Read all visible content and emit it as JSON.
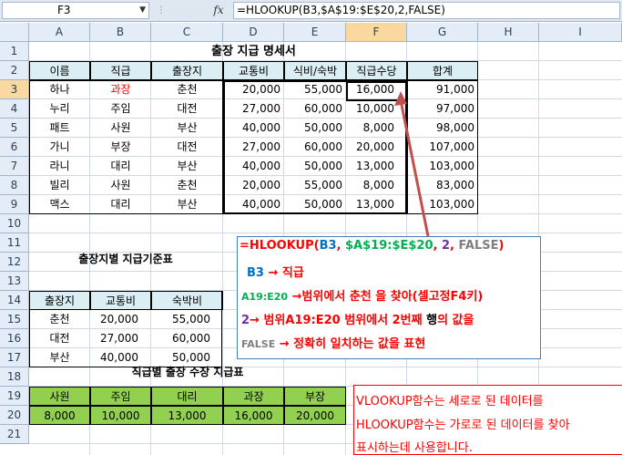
{
  "formula_bar": {
    "name_box": "F3",
    "fx": "fx",
    "formula": "=HLOOKUP(B3,$A$19:$E$20,2,FALSE)"
  },
  "columns": [
    "A",
    "B",
    "C",
    "D",
    "E",
    "F",
    "G",
    "H",
    "I"
  ],
  "rows": [
    "1",
    "2",
    "3",
    "4",
    "5",
    "6",
    "7",
    "8",
    "9",
    "10",
    "11",
    "12",
    "13",
    "14",
    "15",
    "16",
    "17",
    "18",
    "19",
    "20",
    "21"
  ],
  "table1": {
    "title": "출장 지급 명세서",
    "headers": [
      "이름",
      "직급",
      "출장지",
      "교통비",
      "식비/숙박",
      "직급수당",
      "합계"
    ],
    "rows": [
      [
        "하나",
        "과장",
        "춘천",
        "20,000",
        "55,000",
        "16,000",
        "91,000"
      ],
      [
        "누리",
        "주임",
        "대전",
        "27,000",
        "60,000",
        "10,000",
        "97,000"
      ],
      [
        "패트",
        "사원",
        "부산",
        "40,000",
        "50,000",
        "8,000",
        "98,000"
      ],
      [
        "가니",
        "부장",
        "대전",
        "27,000",
        "60,000",
        "20,000",
        "107,000"
      ],
      [
        "라니",
        "대리",
        "부산",
        "40,000",
        "50,000",
        "13,000",
        "103,000"
      ],
      [
        "빌리",
        "사원",
        "춘천",
        "20,000",
        "55,000",
        "8,000",
        "83,000"
      ],
      [
        "맥스",
        "대리",
        "부산",
        "40,000",
        "50,000",
        "13,000",
        "103,000"
      ]
    ]
  },
  "table2": {
    "title": "출장지별 지급기준표",
    "headers": [
      "출장지",
      "교통비",
      "숙박비"
    ],
    "rows": [
      [
        "춘천",
        "20,000",
        "55,000"
      ],
      [
        "대전",
        "27,000",
        "60,000"
      ],
      [
        "부산",
        "40,000",
        "50,000"
      ]
    ]
  },
  "table3": {
    "title": "직급별 출장 수장 지급표",
    "headers": [
      "사원",
      "주임",
      "대리",
      "과장",
      "부장"
    ],
    "values": [
      "8,000",
      "10,000",
      "13,000",
      "16,000",
      "20,000"
    ]
  },
  "annotation": {
    "line1_eq": "=HLOOKUP(",
    "line1_b3": "B3",
    "line1_c1": ", ",
    "line1_range": "$A$19:$E$20",
    "line1_c2": ", ",
    "line1_two": "2",
    "line1_c3": ", ",
    "line1_false": "FALSE",
    "line1_end": ")",
    "line2_b3": "B3",
    "line2_rest": " → 직급",
    "line3_range": "A19:E20",
    "line3_rest": " →범위에서 춘천 을 찾아(셀고정F4키)",
    "line4_two": "2",
    "line4_rest": "→ 범위A19:E20 범위에서 2번째 ",
    "line4_bold": "행",
    "line4_end": "의 값을",
    "line5_false": "FALSE",
    "line5_rest": " → 정확히 일치하는 값을 표현"
  },
  "note": {
    "line1": "VLOOKUP함수는 세로로 된 데이터를",
    "line2": "HLOOKUP함수는 가로로 된 데이터를 찾아",
    "line3": "표시하는데 사용합니다."
  },
  "colors": {
    "header_fill": "#dbeef4",
    "green_fill": "#92d050",
    "red": "#ff0000",
    "blue": "#0070c0",
    "green": "#00b050",
    "purple": "#7030a0",
    "gray": "#7f7f7f"
  }
}
